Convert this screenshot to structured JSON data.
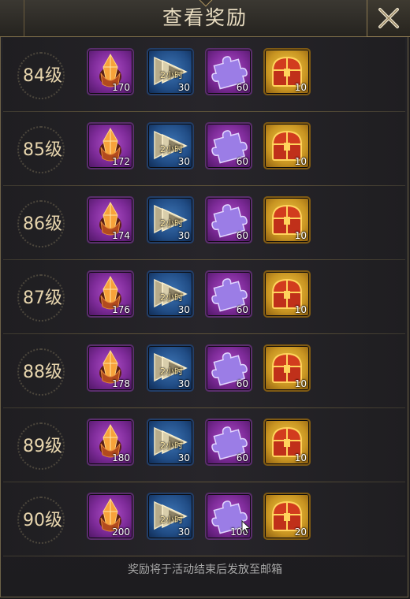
{
  "title": "查看奖励",
  "close_icon": "close-icon",
  "footer_note": "奖励将于活动结束后发放至邮箱",
  "colors": {
    "purple_slot": "#7e2b99",
    "blue_slot": "#214d86",
    "gold_slot": "#c99522",
    "accent_border": "#7a6a48"
  },
  "rewards": [
    {
      "level": "84级",
      "items": [
        {
          "icon": "crystal-icon",
          "qty": "170"
        },
        {
          "icon": "speedup-icon",
          "tag": "2小时",
          "qty": "30"
        },
        {
          "icon": "puzzle-icon",
          "qty": "60"
        },
        {
          "icon": "chest-icon",
          "qty": "10"
        }
      ]
    },
    {
      "level": "85级",
      "items": [
        {
          "icon": "crystal-icon",
          "qty": "172"
        },
        {
          "icon": "speedup-icon",
          "tag": "2小时",
          "qty": "30"
        },
        {
          "icon": "puzzle-icon",
          "qty": "60"
        },
        {
          "icon": "chest-icon",
          "qty": "10"
        }
      ]
    },
    {
      "level": "86级",
      "items": [
        {
          "icon": "crystal-icon",
          "qty": "174"
        },
        {
          "icon": "speedup-icon",
          "tag": "2小时",
          "qty": "30"
        },
        {
          "icon": "puzzle-icon",
          "qty": "60"
        },
        {
          "icon": "chest-icon",
          "qty": "10"
        }
      ]
    },
    {
      "level": "87级",
      "items": [
        {
          "icon": "crystal-icon",
          "qty": "176"
        },
        {
          "icon": "speedup-icon",
          "tag": "2小时",
          "qty": "30"
        },
        {
          "icon": "puzzle-icon",
          "qty": "60"
        },
        {
          "icon": "chest-icon",
          "qty": "10"
        }
      ]
    },
    {
      "level": "88级",
      "items": [
        {
          "icon": "crystal-icon",
          "qty": "178"
        },
        {
          "icon": "speedup-icon",
          "tag": "2小时",
          "qty": "30"
        },
        {
          "icon": "puzzle-icon",
          "qty": "60"
        },
        {
          "icon": "chest-icon",
          "qty": "10"
        }
      ]
    },
    {
      "level": "89级",
      "items": [
        {
          "icon": "crystal-icon",
          "qty": "180"
        },
        {
          "icon": "speedup-icon",
          "tag": "2小时",
          "qty": "30"
        },
        {
          "icon": "puzzle-icon",
          "qty": "60"
        },
        {
          "icon": "chest-icon",
          "qty": "10"
        }
      ]
    },
    {
      "level": "90级",
      "items": [
        {
          "icon": "crystal-icon",
          "qty": "200"
        },
        {
          "icon": "speedup-icon",
          "tag": "2小时",
          "qty": "30"
        },
        {
          "icon": "puzzle-icon",
          "qty": "100"
        },
        {
          "icon": "chest-icon",
          "qty": "20"
        }
      ]
    }
  ]
}
